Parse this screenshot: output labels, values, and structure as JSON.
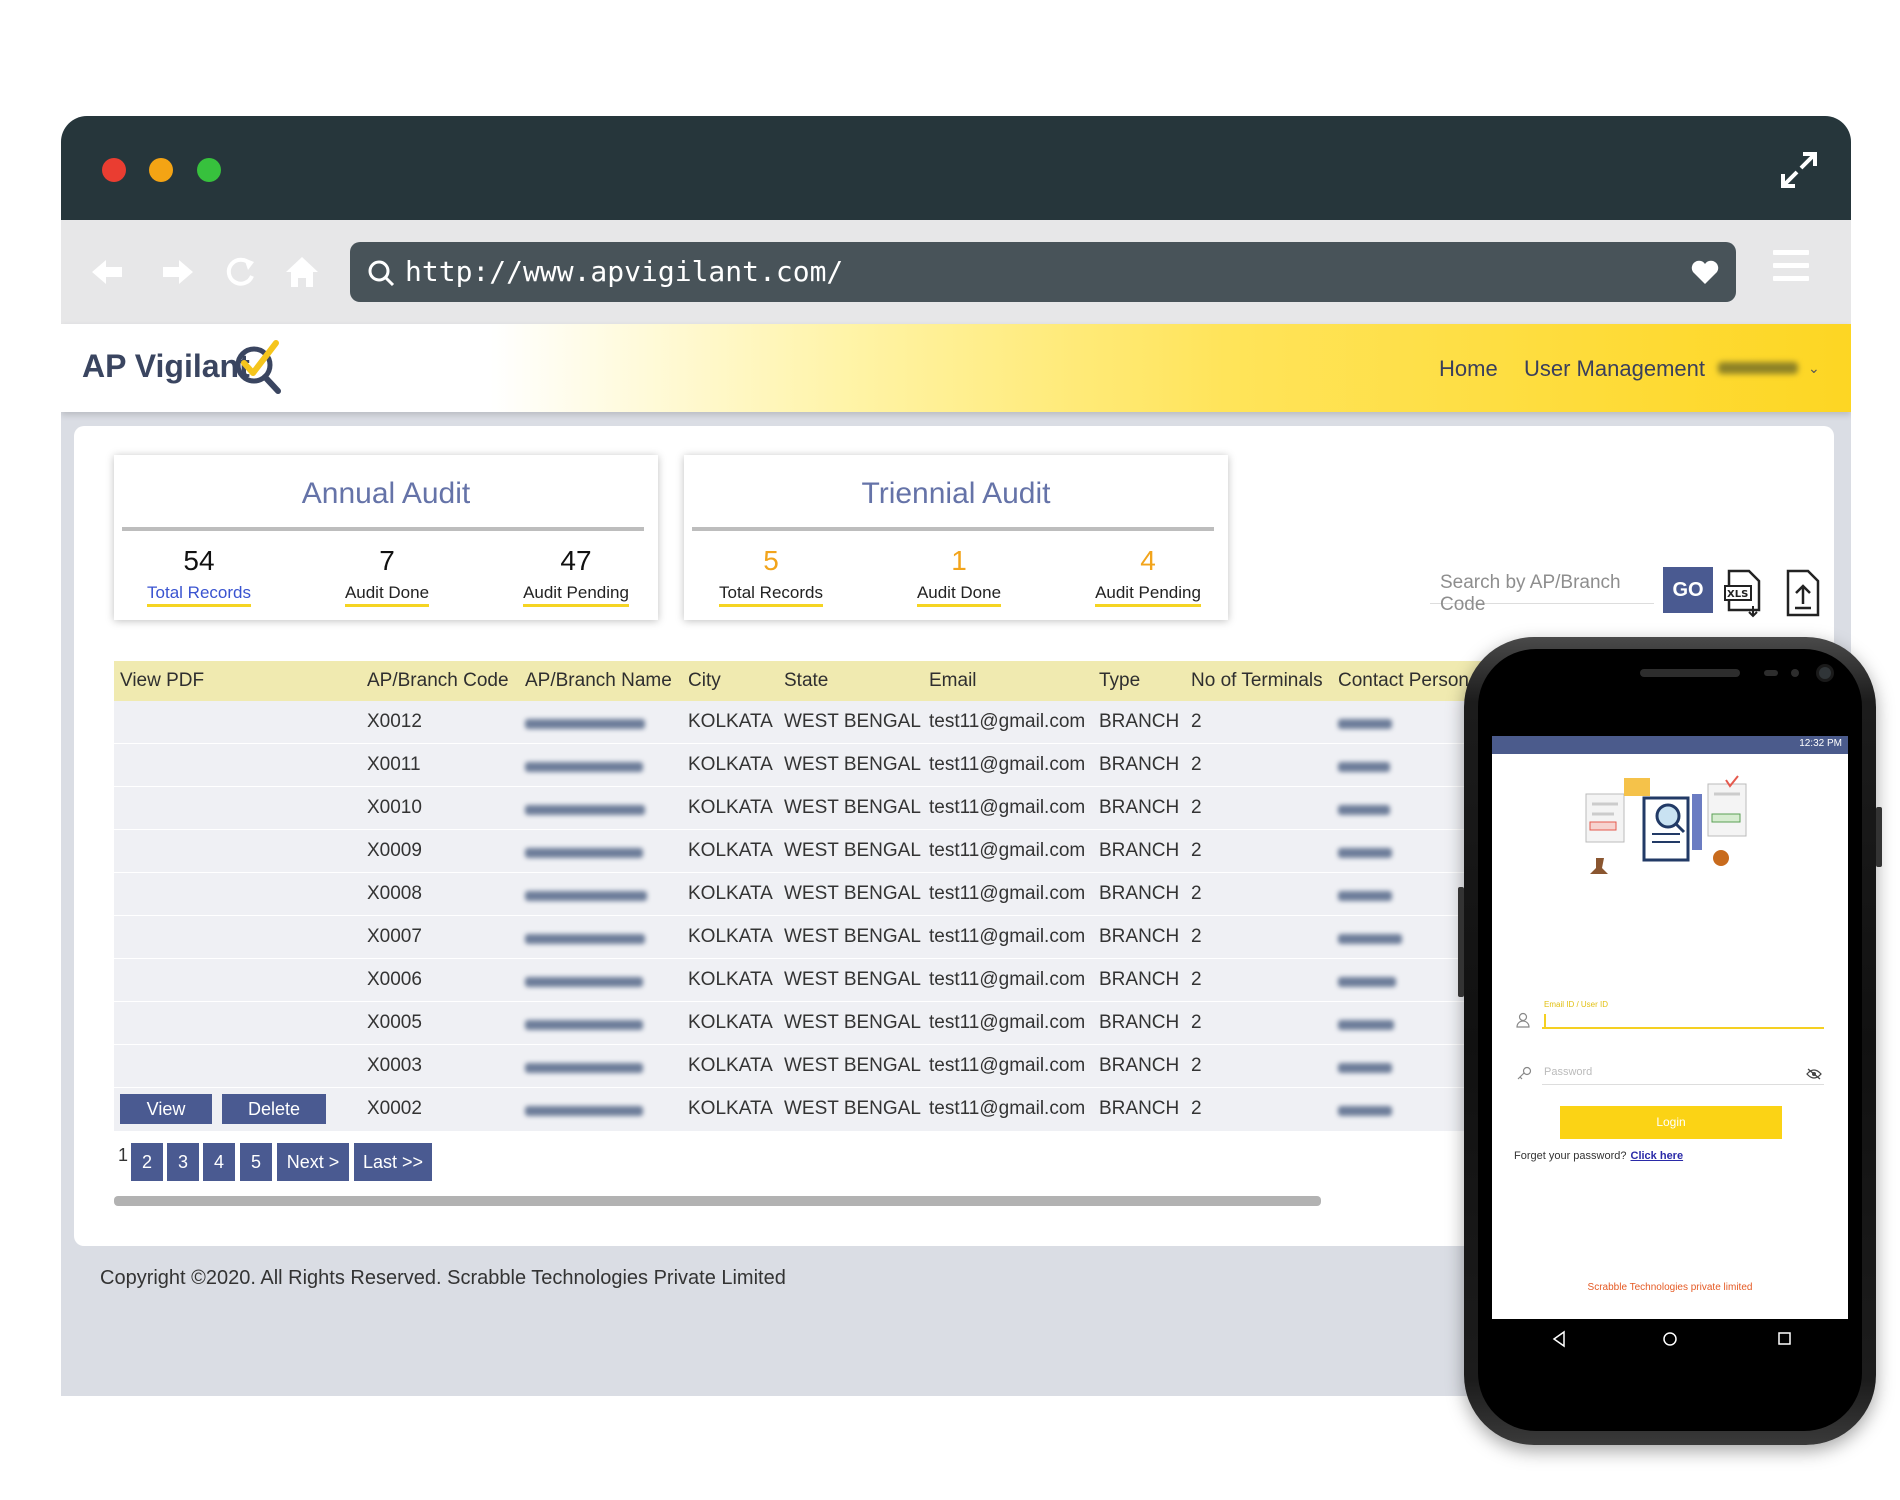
{
  "browser": {
    "url": "http://www.apvigilant.com/"
  },
  "header": {
    "logo": "AP Vigilant",
    "menu": [
      "Home",
      "User Management"
    ]
  },
  "annual_audit": {
    "title": "Annual Audit",
    "stats": [
      {
        "value": "54",
        "label": "Total Records"
      },
      {
        "value": "7",
        "label": "Audit Done"
      },
      {
        "value": "47",
        "label": "Audit Pending"
      }
    ]
  },
  "triennial_audit": {
    "title": "Triennial Audit",
    "stats": [
      {
        "value": "5",
        "label": "Total Records"
      },
      {
        "value": "1",
        "label": "Audit Done"
      },
      {
        "value": "4",
        "label": "Audit Pending"
      }
    ]
  },
  "search": {
    "placeholder": "Search by AP/Branch Code",
    "go_label": "GO"
  },
  "table": {
    "columns": [
      "View PDF",
      "AP/Branch Code",
      "AP/Branch Name",
      "City",
      "State",
      "Email",
      "Type",
      "No of Terminals",
      "Contact Person"
    ],
    "rows": [
      {
        "code": "X0012",
        "city": "KOLKATA",
        "state": "WEST BENGAL",
        "email": "test11@gmail.com",
        "type": "BRANCH",
        "terminals": "2"
      },
      {
        "code": "X0011",
        "city": "KOLKATA",
        "state": "WEST BENGAL",
        "email": "test11@gmail.com",
        "type": "BRANCH",
        "terminals": "2"
      },
      {
        "code": "X0010",
        "city": "KOLKATA",
        "state": "WEST BENGAL",
        "email": "test11@gmail.com",
        "type": "BRANCH",
        "terminals": "2"
      },
      {
        "code": "X0009",
        "city": "KOLKATA",
        "state": "WEST BENGAL",
        "email": "test11@gmail.com",
        "type": "BRANCH",
        "terminals": "2"
      },
      {
        "code": "X0008",
        "city": "KOLKATA",
        "state": "WEST BENGAL",
        "email": "test11@gmail.com",
        "type": "BRANCH",
        "terminals": "2"
      },
      {
        "code": "X0007",
        "city": "KOLKATA",
        "state": "WEST BENGAL",
        "email": "test11@gmail.com",
        "type": "BRANCH",
        "terminals": "2"
      },
      {
        "code": "X0006",
        "city": "KOLKATA",
        "state": "WEST BENGAL",
        "email": "test11@gmail.com",
        "type": "BRANCH",
        "terminals": "2"
      },
      {
        "code": "X0005",
        "city": "KOLKATA",
        "state": "WEST BENGAL",
        "email": "test11@gmail.com",
        "type": "BRANCH",
        "terminals": "2"
      },
      {
        "code": "X0003",
        "city": "KOLKATA",
        "state": "WEST BENGAL",
        "email": "test11@gmail.com",
        "type": "BRANCH",
        "terminals": "2"
      },
      {
        "code": "X0002",
        "city": "KOLKATA",
        "state": "WEST BENGAL",
        "email": "test11@gmail.com",
        "type": "BRANCH",
        "terminals": "2"
      }
    ],
    "actions": {
      "view": "View",
      "delete": "Delete"
    }
  },
  "pagination": {
    "current": "1",
    "pages": [
      "2",
      "3",
      "4",
      "5"
    ],
    "next": "Next >",
    "last": "Last >>"
  },
  "footer": {
    "copyright": "Copyright ©2020. All Rights Reserved. Scrabble Technologies Private Limited"
  },
  "mobile": {
    "time": "12:32 PM",
    "email_label": "Email ID / User ID",
    "password_placeholder": "Password",
    "login_label": "Login",
    "forgot_text": "Forget your password?",
    "forgot_link": "Click here",
    "company": "Scrabble Technologies private limited"
  },
  "colors": {
    "accent": "#4a5a91",
    "header_yellow": "#fdd623",
    "titlebar": "#26363b"
  }
}
